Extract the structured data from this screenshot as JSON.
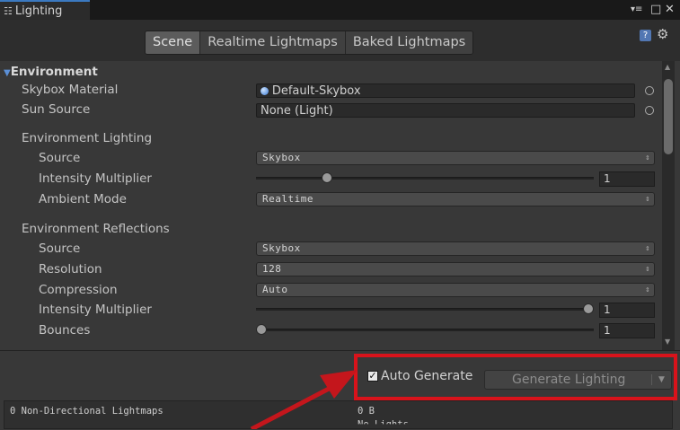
{
  "window": {
    "tab_title": "Lighting",
    "tab_icon": "lighting-sliders-icon",
    "menu_glyph": "▾≡",
    "maximize_glyph": "□",
    "close_glyph": "✕"
  },
  "toolbar": {
    "tabs": [
      {
        "label": "Scene",
        "active": true
      },
      {
        "label": "Realtime Lightmaps",
        "active": false
      },
      {
        "label": "Baked Lightmaps",
        "active": false
      }
    ],
    "help_glyph": "?",
    "settings_glyph": "⚙"
  },
  "environment": {
    "header": "Environment",
    "skybox_material_label": "Skybox Material",
    "skybox_material_value": "Default-Skybox",
    "sun_source_label": "Sun Source",
    "sun_source_value": "None (Light)",
    "lighting_header": "Environment Lighting",
    "lighting_source_label": "Source",
    "lighting_source_value": "Skybox",
    "intensity_label": "Intensity Multiplier",
    "intensity_value": "1",
    "intensity_slider_fraction": 0.2,
    "ambient_mode_label": "Ambient Mode",
    "ambient_mode_value": "Realtime",
    "reflections_header": "Environment Reflections",
    "refl_source_label": "Source",
    "refl_source_value": "Skybox",
    "resolution_label": "Resolution",
    "resolution_value": "128",
    "compression_label": "Compression",
    "compression_value": "Auto",
    "refl_intensity_label": "Intensity Multiplier",
    "refl_intensity_value": "1",
    "refl_intensity_slider_fraction": 1.0,
    "bounces_label": "Bounces",
    "bounces_value": "1",
    "bounces_slider_fraction": 0.0
  },
  "footer": {
    "auto_generate_label": "Auto Generate",
    "auto_generate_checked": true,
    "generate_button_label": "Generate Lighting",
    "stats_label": "0 Non-Directional Lightmaps",
    "stats_size": "0 B",
    "stats_extra": "No Lights"
  },
  "colors": {
    "highlight_box": "#d8131b",
    "annotation_arrow": "#c4161c",
    "active_tab_accent": "#3b79c0"
  }
}
